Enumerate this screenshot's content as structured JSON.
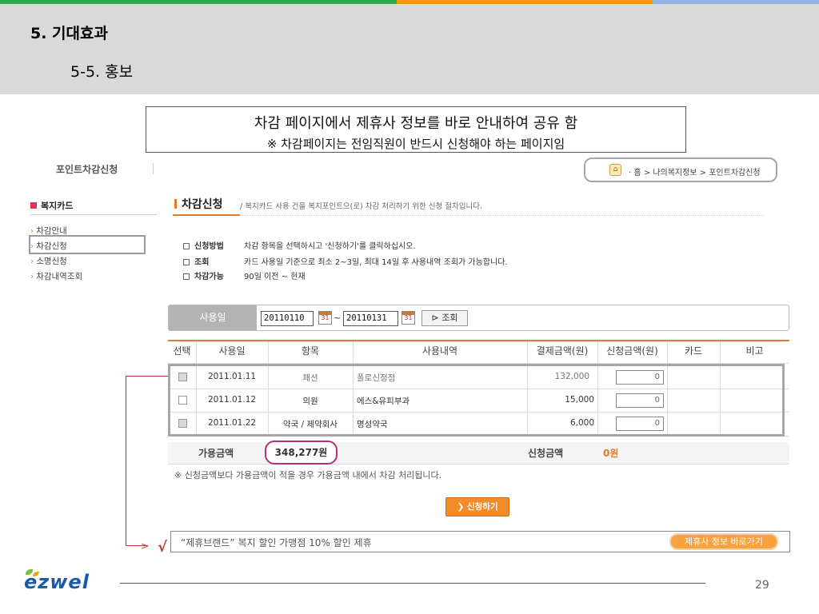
{
  "slide": {
    "section_title": "5. 기대효과",
    "subsection_title": "5-5. 홍보",
    "callout_line1": "차감 페이지에서 제휴사 정보를 바로 안내하여 공유 함",
    "callout_line2": "※ 차감페이지는 전임직원이 반드시 신청해야 하는 페이지임",
    "page_number": "29"
  },
  "screen": {
    "page_title": "포인트차감신청",
    "breadcrumb": "· 홈 > 나의복지정보 > 포인트차감신청",
    "sidebar": {
      "title": "복지카드",
      "items": [
        {
          "label": "차감안내"
        },
        {
          "label": "차감신청"
        },
        {
          "label": "소명신청"
        },
        {
          "label": "차감내역조회"
        }
      ]
    },
    "main": {
      "title": "차감신청",
      "subtitle": "/  복지카드 사용 건을 복지포인트으(로) 차감 처리하기 위한 신청 절차입니다.",
      "info": [
        {
          "label": "신청방법",
          "text": "차감 항목을 선택하시고 '신청하기'를 클릭하십시오."
        },
        {
          "label": "조회",
          "text": "카드 사용일 기준으로 최소 2~3일, 최대 14일 후 사용내역 조회가 가능합니다."
        },
        {
          "label": "차감가능",
          "text": "90일 이전 ~ 현재"
        }
      ]
    },
    "search": {
      "label": "사용일",
      "date_from": "20110110",
      "date_to": "20110131",
      "separator": "~",
      "calendar_icon_text": "31",
      "button_label": "조회"
    },
    "table": {
      "headers": [
        "선택",
        "사용일",
        "항목",
        "사용내역",
        "결제금액(원)",
        "신청금액(원)",
        "카드",
        "비고"
      ],
      "rows": [
        {
          "date": "2011.01.11",
          "item": "패션",
          "detail": "폴로신정점",
          "paid": "132,000",
          "applied": "0"
        },
        {
          "date": "2011.01.12",
          "item": "의원",
          "detail": "에스&유피부과",
          "paid": "15,000",
          "applied": "0"
        },
        {
          "date": "2011.01.22",
          "item": "약국 / 제약회사",
          "detail": "명성약국",
          "paid": "6,000",
          "applied": "0"
        }
      ]
    },
    "summary": {
      "available_label": "가용금액",
      "available_value": "348,277원",
      "applied_label": "신청금액",
      "applied_value": "0원"
    },
    "note": "※ 신청금액보다 가용금액이 적을 경우 가용금액 내에서 차감 처리됩니다.",
    "apply_button": "신청하기",
    "partner": {
      "text": "“제휴브랜드” 복지 할인 가맹점 10% 할인 제휴",
      "button": "제휴사 정보 바로가기"
    }
  },
  "footer": {
    "logo_text": "ezwel"
  },
  "colors": {
    "accent_orange": "#e8782a",
    "highlight_magenta": "#b0307a",
    "connector_red": "#c0392b",
    "header_grey": "#d9d9d9"
  }
}
